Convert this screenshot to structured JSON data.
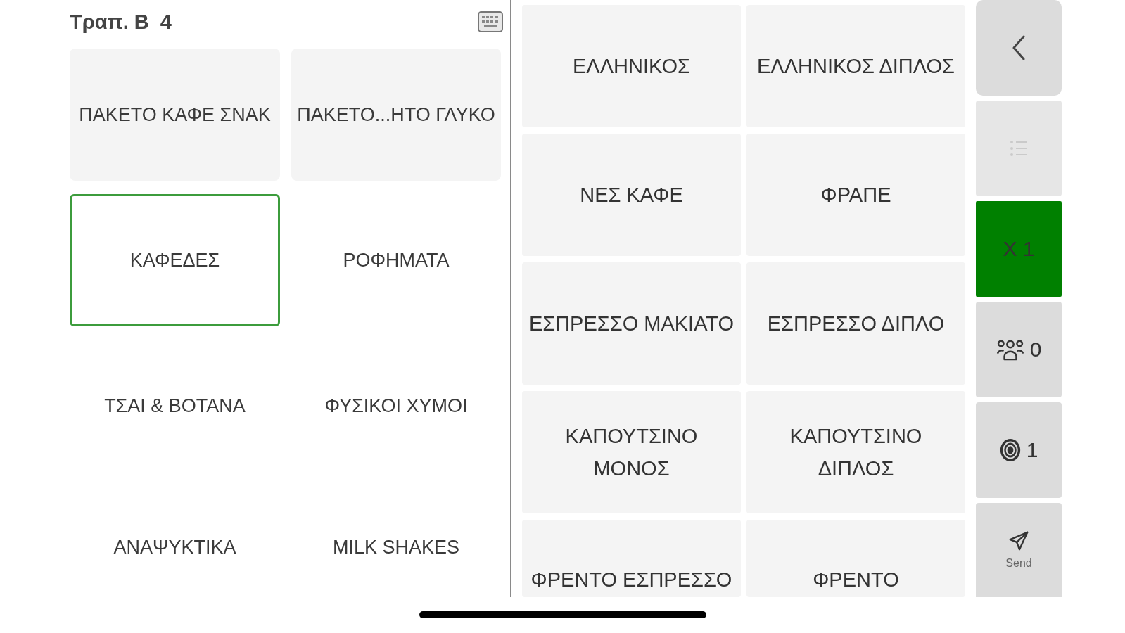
{
  "header": {
    "title": "Τραπ. Β  4"
  },
  "categories": [
    {
      "label": "ΠΑΚΕΤΟ ΚΑΦΕ ΣΝΑΚ",
      "kind": "package",
      "selected": false
    },
    {
      "label": "ΠΑΚΕΤΟ...ΗΤΟ ΓΛΥΚΟ",
      "kind": "package",
      "selected": false
    },
    {
      "label": "ΚΑΦΕΔΕΣ",
      "kind": "category",
      "selected": true
    },
    {
      "label": "ΡΟΦΗΜΑΤΑ",
      "kind": "category",
      "selected": false
    },
    {
      "label": "ΤΣΑΙ & ΒΟΤΑΝΑ",
      "kind": "category",
      "selected": false
    },
    {
      "label": "ΦΥΣΙΚΟΙ ΧΥΜΟΙ",
      "kind": "category",
      "selected": false
    },
    {
      "label": "ΑΝΑΨΥΚΤΙΚΑ",
      "kind": "category",
      "selected": false
    },
    {
      "label": "MILK SHAKES",
      "kind": "category",
      "selected": false
    }
  ],
  "products": [
    "ΕΛΛΗΝΙΚΟΣ",
    "ΕΛΛΗΝΙΚΟΣ ΔΙΠΛΟΣ",
    "ΝΕΣ ΚΑΦΕ",
    "ΦΡΑΠΕ",
    "ΕΣΠΡΕΣΣΟ ΜΑΚΙΑΤΟ",
    "ΕΣΠΡΕΣΣΟ ΔΙΠΛΟ",
    "ΚΑΠΟΥΤΣΙΝΟ ΜΟΝΟΣ",
    "ΚΑΠΟΥΤΣΙΝΟ ΔΙΠΛΟΣ",
    "ΦΡΕΝΤΟ ΕΣΠΡΕΣΣΟ",
    "ΦΡΕΝΤΟ"
  ],
  "actions": [
    {
      "kind": "back",
      "disabled": false,
      "highlighted": false
    },
    {
      "kind": "list",
      "disabled": true,
      "highlighted": false
    },
    {
      "kind": "quantity",
      "label": "X 1",
      "disabled": false,
      "highlighted": true
    },
    {
      "kind": "guests",
      "label": "0",
      "disabled": false,
      "highlighted": false
    },
    {
      "kind": "coins",
      "label": "1",
      "disabled": false,
      "highlighted": false
    },
    {
      "kind": "send",
      "label": "Send",
      "disabled": false,
      "highlighted": false
    }
  ]
}
